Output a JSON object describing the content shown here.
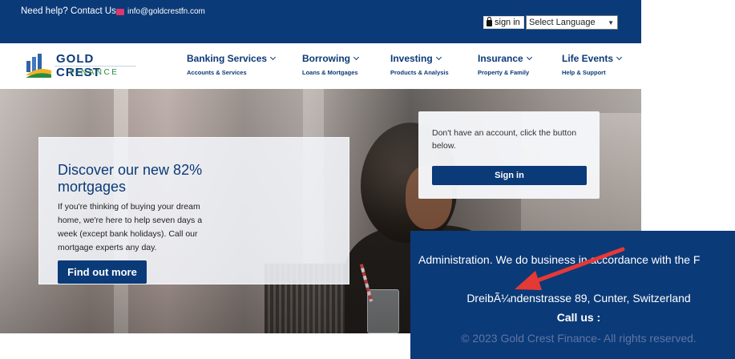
{
  "topbar": {
    "help": "Need help? Contact Us",
    "email": "info@goldcrestfn.com",
    "signin": "sign in",
    "language": "Select Language",
    "icons": {
      "email": "envelope-icon",
      "signin": "lock-icon"
    }
  },
  "logo": {
    "line1": "GOLD CREST",
    "line2": "FINANCE"
  },
  "nav": {
    "items": [
      {
        "title": "Banking Services",
        "sub": "Accounts & Services"
      },
      {
        "title": "Borrowing",
        "sub": "Loans & Mortgages"
      },
      {
        "title": "Investing",
        "sub": "Products & Analysis"
      },
      {
        "title": "Insurance",
        "sub": "Property & Family"
      },
      {
        "title": "Life Events",
        "sub": "Help & Support"
      }
    ]
  },
  "promo": {
    "title": "Discover our new 82% mortgages",
    "text": "If you're thinking of buying your dream home, we're here to help seven days a week (except bank holidays). Call our mortgage experts any day.",
    "button": "Find out more"
  },
  "signin_card": {
    "text": "Don't have an account, click the button below.",
    "button": "Sign in"
  },
  "footer": {
    "admin": "Administration. We do business in accordance with the F",
    "address": "DreibÃ¼ndenstrasse 89, Cunter, Switzerland",
    "call": "Call us :",
    "copyright": "© 2023 Gold Crest Finance- All rights reserved."
  },
  "colors": {
    "brand": "#0b3a78",
    "accent_green": "#2b8a3e",
    "annotation_arrow": "#e53935"
  }
}
